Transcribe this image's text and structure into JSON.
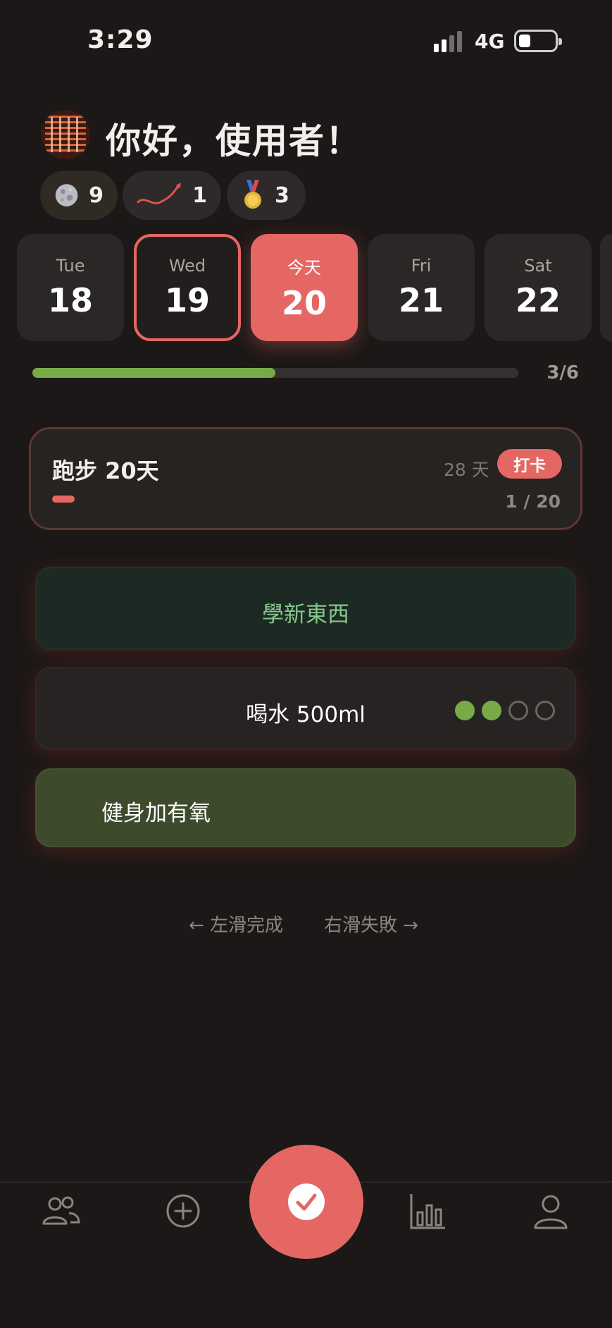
{
  "status_bar": {
    "time": "3:29",
    "network": "4G"
  },
  "header": {
    "greeting": "你好，使用者！"
  },
  "stats": [
    {
      "icon": "moon-icon",
      "count": "9"
    },
    {
      "icon": "snake-icon",
      "count": "1"
    },
    {
      "icon": "medal-icon",
      "count": "3"
    }
  ],
  "days": [
    {
      "name": "Tue",
      "num": "18"
    },
    {
      "name": "Wed",
      "num": "19"
    },
    {
      "name": "今天",
      "num": "20"
    },
    {
      "name": "Fri",
      "num": "21"
    },
    {
      "name": "Sat",
      "num": "22"
    }
  ],
  "progress": {
    "label": "3/6",
    "done": 3,
    "total": 6
  },
  "challenge": {
    "title": "跑步 20天",
    "days_left": "28 天",
    "checkin_label": "打卡",
    "count": "1 / 20",
    "done": 1,
    "total": 20
  },
  "habits": {
    "learn": {
      "label": "學新東西"
    },
    "water": {
      "label": "喝水 500ml",
      "done": 2,
      "total": 4
    },
    "fitness": {
      "label": "健身加有氧"
    }
  },
  "hints": {
    "left": "← 左滑完成",
    "right": "右滑失敗 →"
  },
  "nav": [
    "people-icon",
    "add-icon",
    "check-icon",
    "chart-icon",
    "profile-icon"
  ],
  "colors": {
    "accent": "#e46763",
    "green": "#78aa48",
    "background": "#1c1817"
  }
}
